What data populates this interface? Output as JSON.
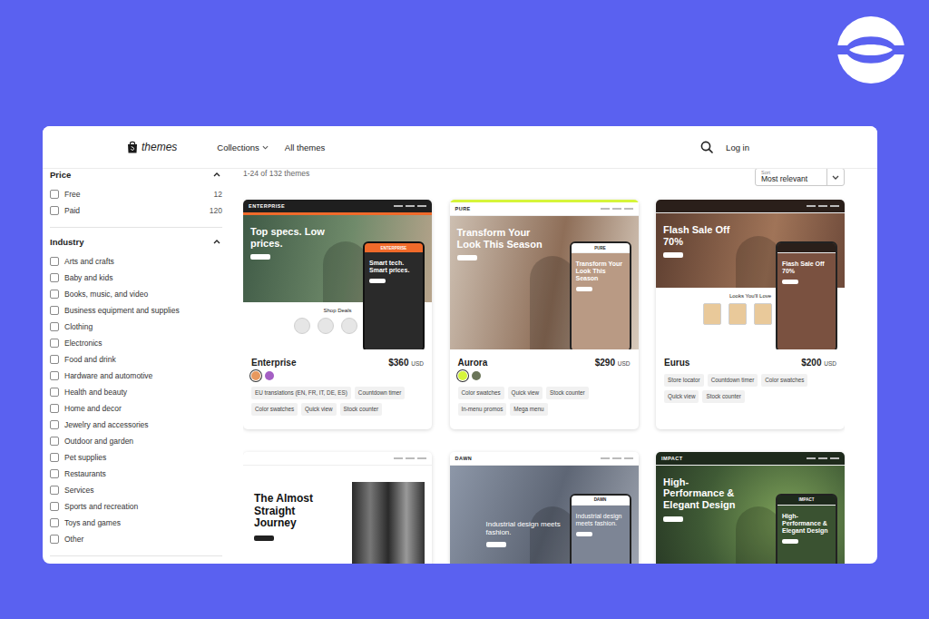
{
  "header": {
    "brand": "themes",
    "nav": [
      {
        "label": "Collections",
        "dropdown": true
      },
      {
        "label": "All themes",
        "dropdown": false
      }
    ],
    "login": "Log in"
  },
  "filters": [
    {
      "title": "Price",
      "expanded": true,
      "options": [
        {
          "label": "Free",
          "count": "12",
          "checked": false
        },
        {
          "label": "Paid",
          "count": "120",
          "checked": false
        }
      ]
    },
    {
      "title": "Industry",
      "expanded": true,
      "options": [
        {
          "label": "Arts and crafts",
          "checked": false
        },
        {
          "label": "Baby and kids",
          "checked": false
        },
        {
          "label": "Books, music, and video",
          "checked": false
        },
        {
          "label": "Business equipment and supplies",
          "checked": false
        },
        {
          "label": "Clothing",
          "checked": false
        },
        {
          "label": "Electronics",
          "checked": false
        },
        {
          "label": "Food and drink",
          "checked": false
        },
        {
          "label": "Hardware and automotive",
          "checked": false
        },
        {
          "label": "Health and beauty",
          "checked": false
        },
        {
          "label": "Home and decor",
          "checked": false
        },
        {
          "label": "Jewelry and accessories",
          "checked": false
        },
        {
          "label": "Outdoor and garden",
          "checked": false
        },
        {
          "label": "Pet supplies",
          "checked": false
        },
        {
          "label": "Restaurants",
          "checked": false
        },
        {
          "label": "Services",
          "checked": false
        },
        {
          "label": "Sports and recreation",
          "checked": false
        },
        {
          "label": "Toys and games",
          "checked": false
        },
        {
          "label": "Other",
          "checked": false
        }
      ]
    }
  ],
  "results": {
    "count": "1-24 of 132 themes",
    "sort": {
      "label": "Sort",
      "value": "Most relevant"
    }
  },
  "cards": [
    {
      "name": "Enterprise",
      "price": "$360",
      "currency": "USD",
      "swatches": [
        {
          "color": "#e8995f",
          "selected": true
        },
        {
          "color": "#a45fc4",
          "selected": false
        }
      ],
      "tags": [
        "EU translations (EN, FR, IT, DE, ES)",
        "Countdown timer",
        "Color swatches",
        "Quick view",
        "Stock counter"
      ],
      "preview": {
        "kind": "enterprise",
        "logo": "ENTERPRISE",
        "headline": "Top specs. Low prices.",
        "phoneText": "Smart tech. Smart prices.",
        "section": "Shop Deals"
      }
    },
    {
      "name": "Aurora",
      "price": "$290",
      "currency": "USD",
      "swatches": [
        {
          "color": "#d6f53a",
          "selected": true
        },
        {
          "color": "#6a7558",
          "selected": false
        }
      ],
      "tags": [
        "Color swatches",
        "Quick view",
        "Stock counter",
        "In-menu promos",
        "Mega menu"
      ],
      "preview": {
        "kind": "aurora",
        "logo": "PURE",
        "headline": "Transform Your Look This Season",
        "phoneText": "Transform Your Look This Season",
        "section": ""
      }
    },
    {
      "name": "Eurus",
      "price": "$200",
      "currency": "USD",
      "swatches": [],
      "tags": [
        "Store locator",
        "Countdown timer",
        "Color swatches",
        "Quick view",
        "Stock counter"
      ],
      "preview": {
        "kind": "eurus",
        "logo": "",
        "headline": "Flash Sale Off 70%",
        "phoneText": "Flash Sale Off 70%",
        "section": "Looks You'll Love"
      }
    },
    {
      "name": "",
      "price": "",
      "currency": "",
      "swatches": [],
      "tags": [],
      "preview": {
        "kind": "journey",
        "logo": "",
        "headline": "The Almost Straight Journey",
        "phoneText": "",
        "section": ""
      }
    },
    {
      "name": "",
      "price": "",
      "currency": "",
      "swatches": [],
      "tags": [],
      "preview": {
        "kind": "dawn",
        "logo": "DAWN",
        "headline": "Industrial design meets fashion.",
        "phoneText": "Industrial design meets fashion.",
        "section": ""
      }
    },
    {
      "name": "",
      "price": "",
      "currency": "",
      "swatches": [],
      "tags": [],
      "preview": {
        "kind": "impact",
        "logo": "IMPACT",
        "headline": "High-Performance & Elegant Design",
        "phoneText": "High-Performance & Elegant Design",
        "section": ""
      }
    }
  ]
}
